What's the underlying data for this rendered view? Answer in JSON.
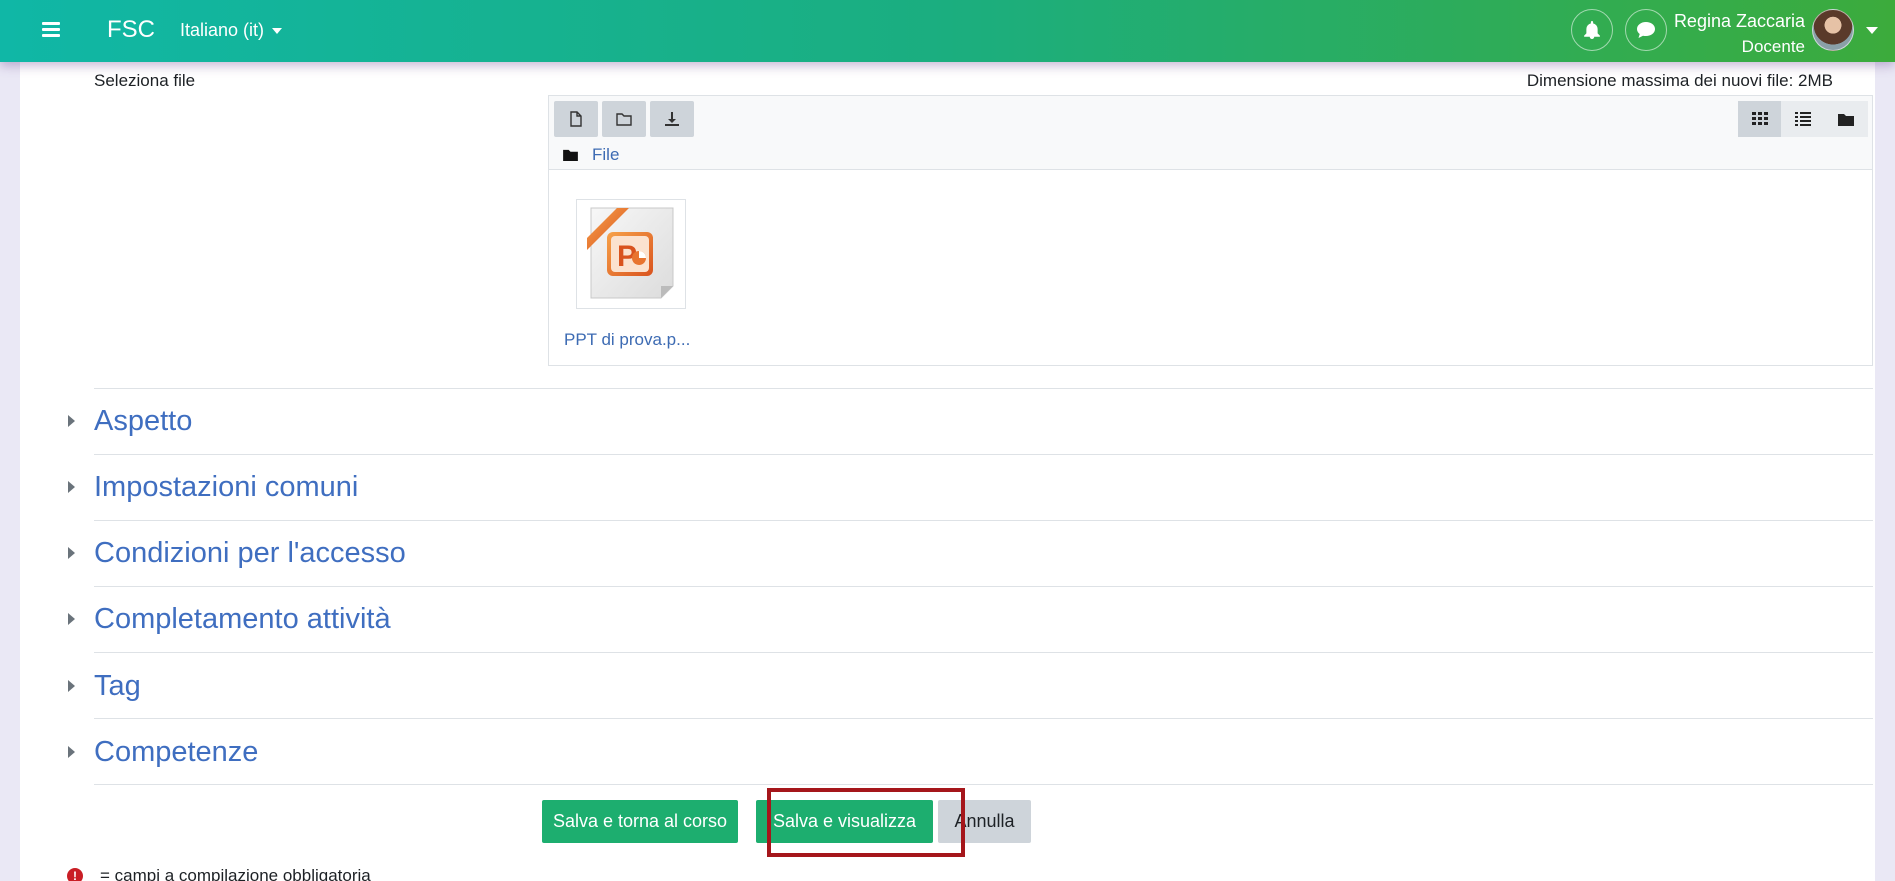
{
  "navbar": {
    "brand": "FSC",
    "language": "Italiano ‎(it)‎",
    "user_name": "Regina Zaccaria",
    "user_role": "Docente"
  },
  "filepicker": {
    "label": "Seleziona file",
    "max_size": "Dimensione massima dei nuovi file: 2MB",
    "breadcrumb": "File",
    "file_name": "PPT di prova.p..."
  },
  "sections": [
    {
      "title": "Aspetto"
    },
    {
      "title": "Impostazioni comuni"
    },
    {
      "title": "Condizioni per l'accesso"
    },
    {
      "title": "Completamento attività"
    },
    {
      "title": "Tag"
    },
    {
      "title": "Competenze"
    }
  ],
  "buttons": {
    "save_return": "Salva e torna al corso",
    "save_view": "Salva e visualizza",
    "cancel": "Annulla"
  },
  "required_note": "= campi a compilazione obbligatoria",
  "colors": {
    "accent_green": "#1dae6f",
    "link_blue": "#3f6ec0",
    "highlight_red": "#a5161b"
  }
}
